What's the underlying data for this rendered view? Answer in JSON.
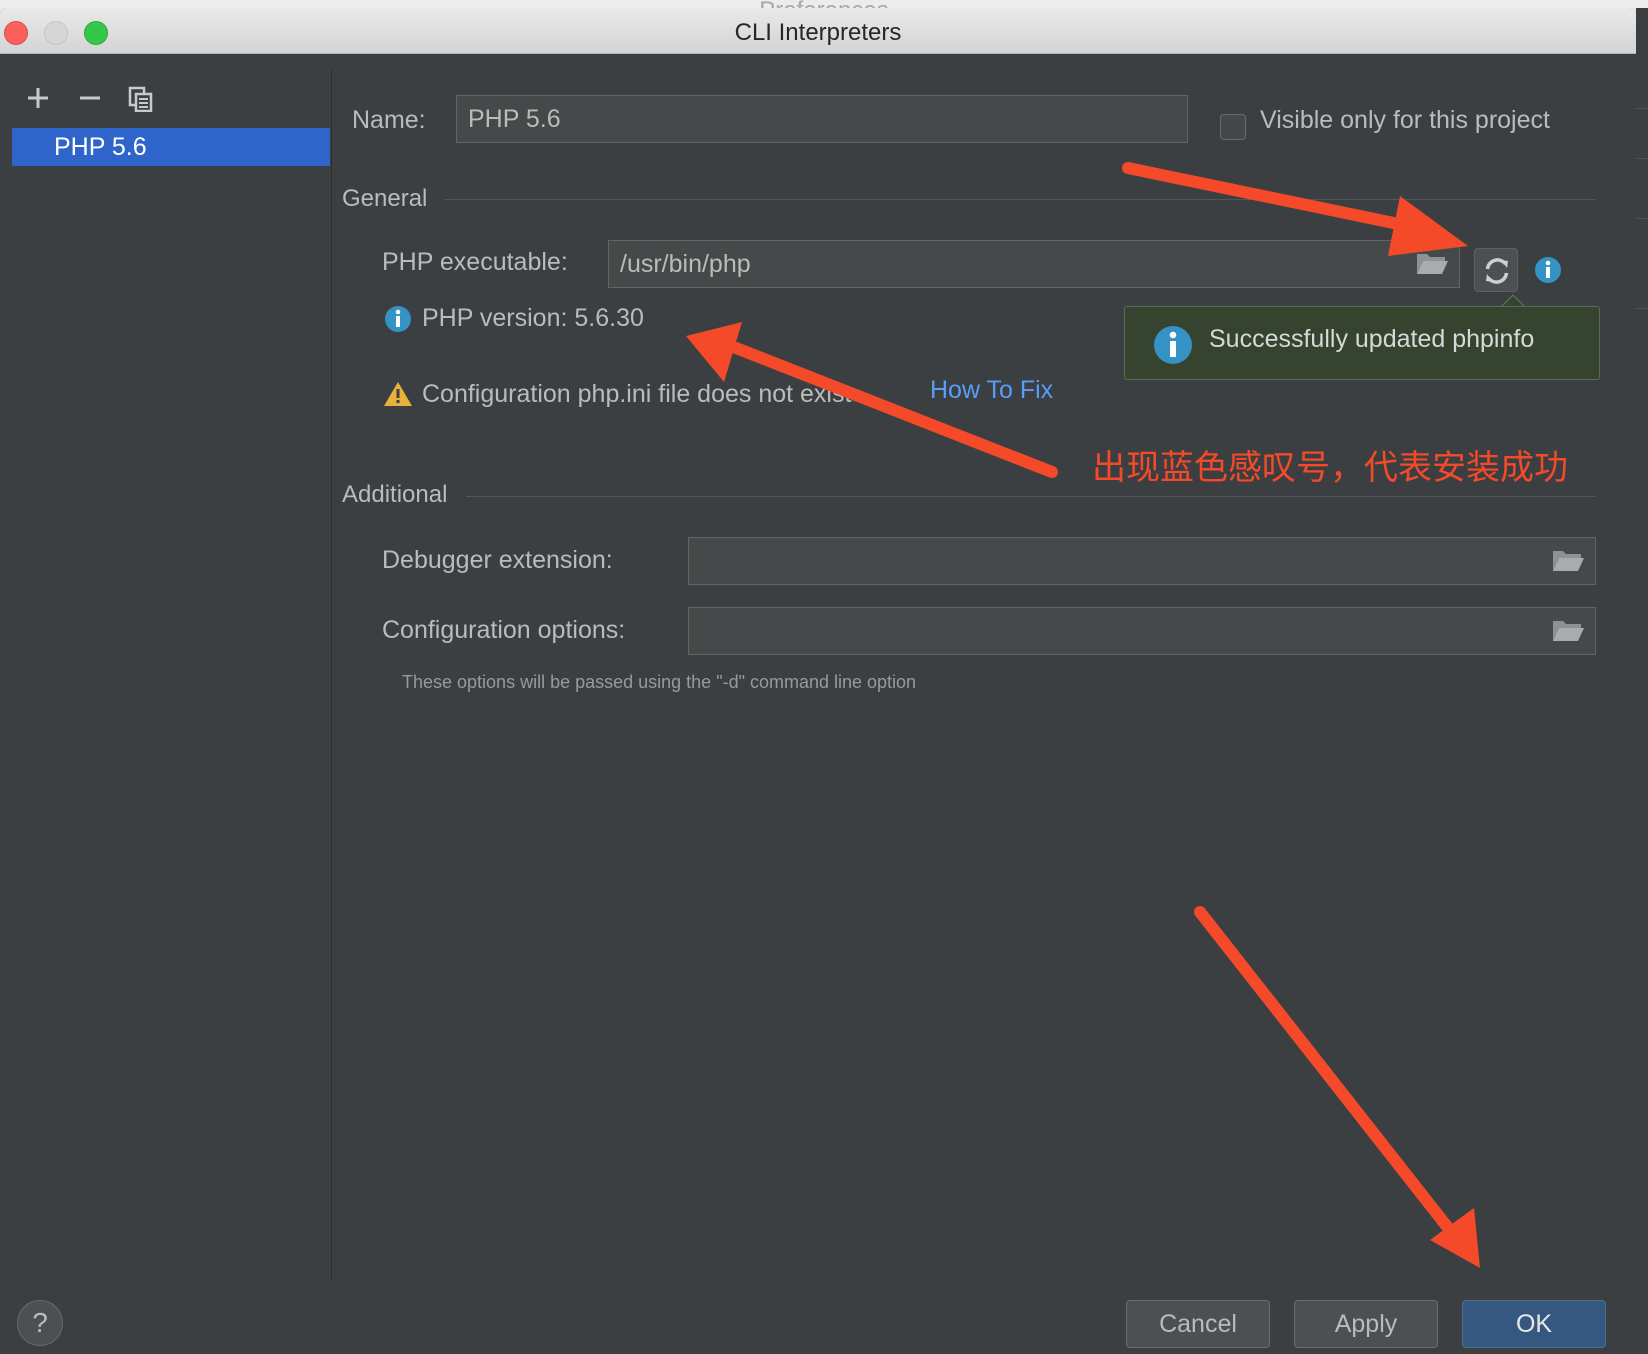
{
  "background_window": {
    "title": "Preferences"
  },
  "window": {
    "title": "CLI Interpreters"
  },
  "sidebar": {
    "toolbar": {
      "add_icon": "plus-icon",
      "remove_icon": "minus-icon",
      "copy_icon": "copy-icon"
    },
    "items": [
      {
        "label": "PHP 5.6",
        "selected": true
      }
    ]
  },
  "form": {
    "name_label": "Name:",
    "name_value": "PHP 5.6",
    "visible_only_label": "Visible only for this project",
    "visible_only_checked": false,
    "general_section": "General",
    "php_executable_label": "PHP executable:",
    "php_executable_value": "/usr/bin/php",
    "php_version_text": "PHP version: 5.6.30",
    "config_warning_text": "Configuration php.ini file does not exist",
    "how_to_fix_link": "How To Fix",
    "additional_section": "Additional",
    "debugger_extension_label": "Debugger extension:",
    "debugger_extension_value": "",
    "configuration_options_label": "Configuration options:",
    "configuration_options_value": "",
    "options_hint": "These options will be passed using the \"-d\" command line option"
  },
  "notification": {
    "text": "Successfully updated phpinfo",
    "icon": "info-icon"
  },
  "annotation": {
    "text": "出现蓝色感叹号，代表安装成功",
    "color": "#f44a2a"
  },
  "buttons": {
    "help": "?",
    "cancel": "Cancel",
    "apply": "Apply",
    "ok": "OK"
  },
  "colors": {
    "accent": "#2f65ca",
    "link": "#589df6",
    "default_button": "#365880",
    "info_icon": "#3592c4",
    "warning_icon": "#e8b23a"
  }
}
